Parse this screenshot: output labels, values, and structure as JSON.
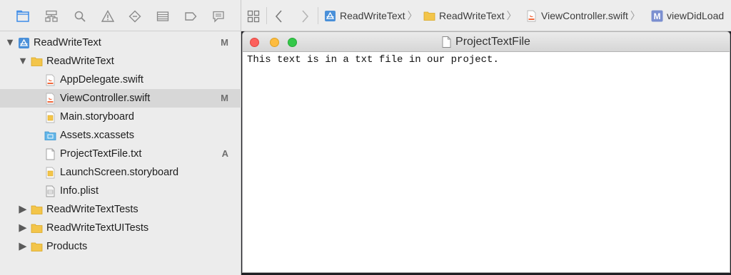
{
  "navigator": {
    "items": [
      {
        "label": "ReadWriteText",
        "badge": "M",
        "icon": "project-icon"
      },
      {
        "label": "ReadWriteText",
        "badge": "",
        "icon": "folder-icon"
      },
      {
        "label": "AppDelegate.swift",
        "badge": "",
        "icon": "swift-file-icon"
      },
      {
        "label": "ViewController.swift",
        "badge": "M",
        "icon": "swift-file-icon"
      },
      {
        "label": "Main.storyboard",
        "badge": "",
        "icon": "storyboard-icon"
      },
      {
        "label": "Assets.xcassets",
        "badge": "",
        "icon": "asset-catalog-icon"
      },
      {
        "label": "ProjectTextFile.txt",
        "badge": "A",
        "icon": "text-file-icon"
      },
      {
        "label": "LaunchScreen.storyboard",
        "badge": "",
        "icon": "storyboard-icon"
      },
      {
        "label": "Info.plist",
        "badge": "",
        "icon": "plist-icon"
      },
      {
        "label": "ReadWriteTextTests",
        "badge": "",
        "icon": "folder-icon"
      },
      {
        "label": "ReadWriteTextUITests",
        "badge": "",
        "icon": "folder-icon"
      },
      {
        "label": "Products",
        "badge": "",
        "icon": "folder-icon"
      }
    ]
  },
  "jumpbar": {
    "crumbs": [
      "ReadWriteText",
      "ReadWriteText",
      "ViewController.swift",
      "viewDidLoad"
    ]
  },
  "window": {
    "title": "ProjectTextFile",
    "content": "This text is in a txt file in our project."
  },
  "colors": {
    "selection": "#d7d7d7",
    "folder": "#f3c54a",
    "accent": "#4a90d9",
    "close": "#fc605c",
    "minimize": "#fdbc40",
    "zoom": "#34c84a"
  }
}
